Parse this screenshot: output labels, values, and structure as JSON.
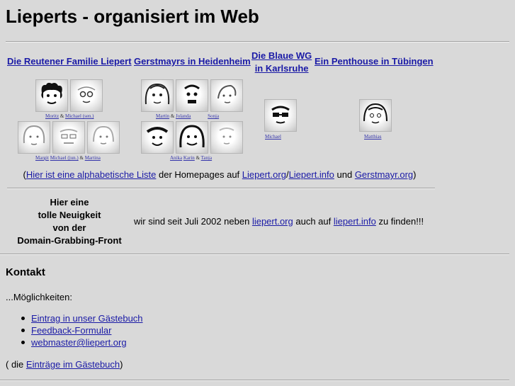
{
  "page": {
    "title": "Lieperts - organisiert im Web"
  },
  "families": [
    {
      "label": "Die Reutener Familie Liepert"
    },
    {
      "label": "Gerstmayrs in Heidenheim"
    },
    {
      "label_line1": "Die Blaue WG",
      "label_line2": "in Karlsruhe"
    },
    {
      "label": "Ein Penthouse in Tübingen"
    }
  ],
  "captions": {
    "reutlingen_row1": {
      "a": "Moritz",
      "amp": "&",
      "b": "Michael (sen.)"
    },
    "reutlingen_row2": {
      "a": "Margit",
      "b": "Michael (jun.)",
      "amp": "&",
      "c": "Martina"
    },
    "heidenheim_row1": {
      "a": "Martin",
      "amp": "&",
      "b": "Jolanda",
      "c": "Sonja"
    },
    "heidenheim_row2": {
      "a": "Anika",
      "b": "Karin",
      "amp": "&",
      "c": "Tanja"
    },
    "wg": {
      "a": "Michael"
    },
    "penthouse": {
      "a": "Matthias"
    }
  },
  "list_line": {
    "open": "(",
    "link": "Hier ist eine alphabetische Liste",
    "mid": " der Homepages auf ",
    "site1": "Liepert.org",
    "slash": "/",
    "site2": "Liepert.info",
    "and": " und ",
    "site3": "Gerstmayr.org",
    "close": ")"
  },
  "news": {
    "heading_l1": "Hier eine",
    "heading_l2": "tolle Neuigkeit",
    "heading_l3": "von der",
    "heading_l4": "Domain-Grabbing-Front",
    "text_before": "wir sind seit Juli 2002 neben ",
    "link1": "liepert.org",
    "text_mid": " auch auf ",
    "link2": "liepert.info",
    "text_after": " zu finden!!!"
  },
  "contact": {
    "heading": "Kontakt",
    "intro": "...Möglichkeiten:",
    "items": [
      {
        "label": "Eintrag in unser Gästebuch"
      },
      {
        "label": "Feedback-Formular"
      },
      {
        "label": "webmaster@liepert.org"
      }
    ],
    "gb_open": "( die ",
    "gb_link": "Einträge im Gästebuch",
    "gb_close": ")"
  }
}
